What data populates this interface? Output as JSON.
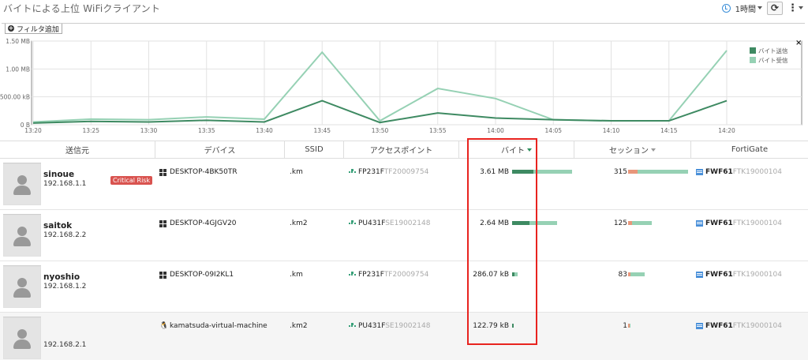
{
  "header": {
    "title": "バイトによる上位 WiFiクライアント",
    "time_range": "1時間",
    "refresh_icon": "refresh-icon",
    "more_icon": "more-vertical-icon"
  },
  "filter": {
    "add_label": "フィルタ追加"
  },
  "chart_data": {
    "type": "line",
    "x": [
      "13:20",
      "13:25",
      "13:30",
      "13:35",
      "13:40",
      "13:45",
      "13:50",
      "13:55",
      "14:00",
      "14:05",
      "14:10",
      "14:15",
      "14:20"
    ],
    "yticks": [
      "0 B",
      "500.00 kB",
      "1.00 MB",
      "1.50 MB"
    ],
    "ylim": [
      0,
      1.5
    ],
    "ylabel": "",
    "series": [
      {
        "name": "バイト送信",
        "color": "#3e8a62",
        "values": [
          0.03,
          0.06,
          0.05,
          0.08,
          0.05,
          0.43,
          0.04,
          0.21,
          0.12,
          0.09,
          0.07,
          0.07,
          0.43
        ]
      },
      {
        "name": "バイト受信",
        "color": "#96d1b4",
        "values": [
          0.05,
          0.1,
          0.09,
          0.14,
          0.1,
          1.3,
          0.07,
          0.65,
          0.47,
          0.09,
          0.07,
          0.07,
          1.33
        ]
      }
    ],
    "legend": "top-right",
    "grid": true
  },
  "table": {
    "columns": {
      "source": "送信元",
      "device": "デバイス",
      "ssid": "SSID",
      "ap": "アクセスポイント",
      "bytes": "バイト",
      "sessions": "セッション",
      "fortigate": "FortiGate"
    },
    "rows": [
      {
        "name": "sinoue",
        "ip": "192.168.1.1",
        "badge": "Critical Risk",
        "os": "windows",
        "device": "DESKTOP-4BK50TR",
        "ssid": ".km",
        "ap_prefix": "FP231F",
        "ap_suffix": "TF20009754",
        "bytes": "3.61 MB",
        "bytes_sent": 1.0,
        "bytes_recv": 1.0,
        "sessions": "315",
        "sess_level": 1.0,
        "fg_prefix": "FWF61",
        "fg_suffix": "FTK19000104"
      },
      {
        "name": "saitok",
        "ip": "192.168.2.2",
        "badge": "",
        "os": "windows",
        "device": "DESKTOP-4GJGV20",
        "ssid": ".km2",
        "ap_prefix": "PU431F",
        "ap_suffix": "SE19002148",
        "bytes": "2.64 MB",
        "bytes_sent": 0.8,
        "bytes_recv": 0.72,
        "sessions": "125",
        "sess_level": 0.4,
        "fg_prefix": "FWF61",
        "fg_suffix": "FTK19000104"
      },
      {
        "name": "nyoshio",
        "ip": "192.168.1.2",
        "badge": "",
        "os": "windows",
        "device": "DESKTOP-09I2KL1",
        "ssid": ".km",
        "ap_prefix": "FP231F",
        "ap_suffix": "TF20009754",
        "bytes": "286.07 kB",
        "bytes_sent": 0.1,
        "bytes_recv": 0.08,
        "sessions": "83",
        "sess_level": 0.27,
        "fg_prefix": "FWF61",
        "fg_suffix": "FTK19000104"
      },
      {
        "name": "",
        "ip": "192.168.2.1",
        "badge": "",
        "os": "linux",
        "device": "kamatsuda-virtual-machine",
        "ssid": ".km2",
        "ap_prefix": "PU431F",
        "ap_suffix": "SE19002148",
        "bytes": "122.79 kB",
        "bytes_sent": 0.04,
        "bytes_recv": 0.0,
        "sessions": "1",
        "sess_level": 0.01,
        "fg_prefix": "FWF61",
        "fg_suffix": "FTK19000104"
      }
    ]
  },
  "colors": {
    "sent": "#3e8a62",
    "recv": "#96d1b4",
    "sess_a": "#e8967a",
    "sess_b": "#96d1b4",
    "risk": "#d9534f",
    "highlight": "#e8231f"
  }
}
